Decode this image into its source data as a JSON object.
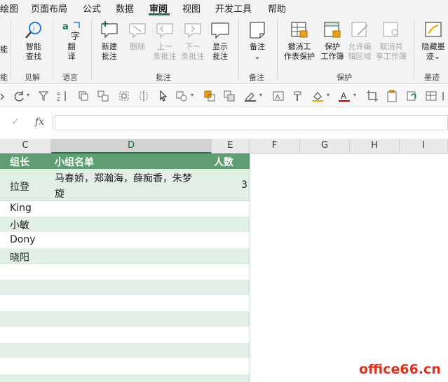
{
  "menu": {
    "items": [
      "绘图",
      "页面布局",
      "公式",
      "数据",
      "审阅",
      "视图",
      "开发工具",
      "帮助"
    ],
    "active": "审阅"
  },
  "ribbon": {
    "left_cut_labels": [
      "能",
      "能"
    ],
    "buttons": {
      "smart_lookup": [
        "智能",
        "查找"
      ],
      "translate": [
        "翻",
        "译"
      ],
      "new_comment": [
        "新建",
        "批注"
      ],
      "delete": [
        "删除"
      ],
      "previous_comment": [
        "上一",
        "条批注"
      ],
      "next_comment": [
        "下一",
        "条批注"
      ],
      "show_comments": [
        "显示",
        "批注"
      ],
      "notes": [
        "备注",
        "⌄"
      ],
      "unprotect_sheet": [
        "撤消工",
        "作表保护"
      ],
      "protect_workbook": [
        "保护",
        "工作簿"
      ],
      "allow_edit_ranges": [
        "允许编",
        "辑区域"
      ],
      "unshare_workbook": [
        "取消共",
        "享工作簿"
      ],
      "hide_ink": [
        "隐藏墨",
        "迹⌄"
      ]
    },
    "groups": {
      "insights": "见解",
      "language": "语言",
      "comments": "批注",
      "notes": "备注",
      "protect": "保护",
      "ink": "墨迹"
    }
  },
  "formula_bar": {
    "cancel_glyph": "✓",
    "fx": "fx",
    "value": ""
  },
  "columns": [
    "C",
    "D",
    "E",
    "F",
    "G",
    "H",
    "I"
  ],
  "table": {
    "headers": {
      "c": "组长",
      "d": "小组名单",
      "e": "人数"
    },
    "rows": [
      {
        "c": "拉登",
        "d_line1": "马春娇，郑瀚海，薛痴香，朱梦",
        "d_line2": "旋",
        "e": "3"
      },
      {
        "c": "King",
        "d": "",
        "e": ""
      },
      {
        "c": "小敏",
        "d": "",
        "e": ""
      },
      {
        "c": "Dony",
        "d": "",
        "e": ""
      },
      {
        "c": "晓阳",
        "d": "",
        "e": ""
      }
    ]
  },
  "watermark": "office66.cn",
  "colors": {
    "header_green": "#5e9e72",
    "band_green": "#e2efe5",
    "accent": "#217346",
    "watermark": "#e0301e"
  }
}
